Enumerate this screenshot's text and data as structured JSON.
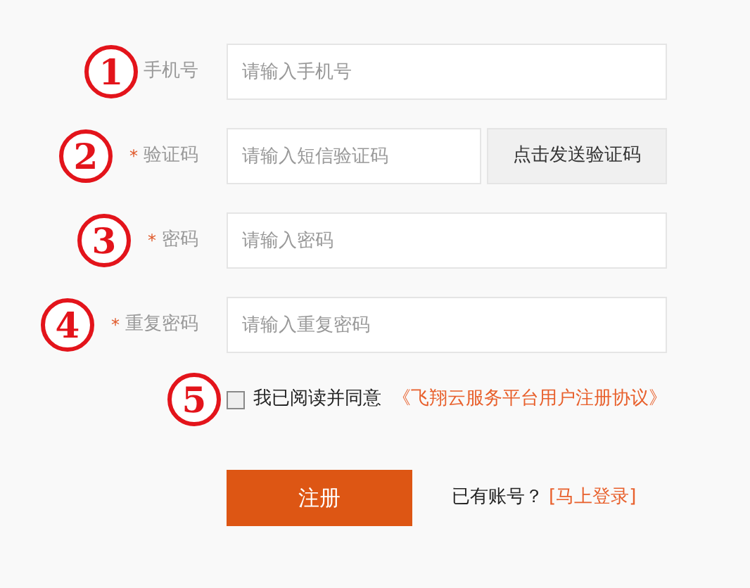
{
  "fields": [
    {
      "annotation": "1",
      "label": "手机号",
      "placeholder": "请输入手机号"
    },
    {
      "annotation": "2",
      "required_mark": "*",
      "label": "验证码",
      "placeholder": "请输入短信验证码",
      "button": "点击发送验证码"
    },
    {
      "annotation": "3",
      "required_mark": "*",
      "label": "密码",
      "placeholder": "请输入密码"
    },
    {
      "annotation": "4",
      "required_mark": "*",
      "label": "重复密码",
      "placeholder": "请输入重复密码"
    }
  ],
  "agreement": {
    "annotation": "5",
    "checked": false,
    "text": "我已阅读并同意",
    "link": "《飞翔云服务平台用户注册协议》"
  },
  "submit": "注册",
  "login_prompt": {
    "text": "已有账号？",
    "link": "[马上登录]"
  }
}
